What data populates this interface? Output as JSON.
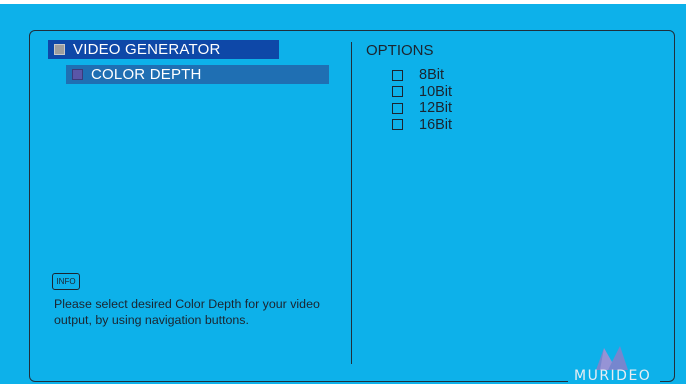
{
  "menu": {
    "root_label": "VIDEO GENERATOR",
    "child_label": "COLOR DEPTH"
  },
  "info": {
    "icon_label": "INFO",
    "text": "Please select desired Color Depth for your video output, by using navigation buttons."
  },
  "options": {
    "title": "OPTIONS",
    "items": [
      {
        "label": "8Bit",
        "checked": false
      },
      {
        "label": "10Bit",
        "checked": false
      },
      {
        "label": "12Bit",
        "checked": false
      },
      {
        "label": "16Bit",
        "checked": false
      }
    ]
  },
  "logo": {
    "text": "MURIDEO"
  },
  "colors": {
    "background": "#0db1ea",
    "menu_root_bg": "#0e48a8",
    "menu_child_bg": "#1f6fb3",
    "text_dark": "#1b2530"
  }
}
